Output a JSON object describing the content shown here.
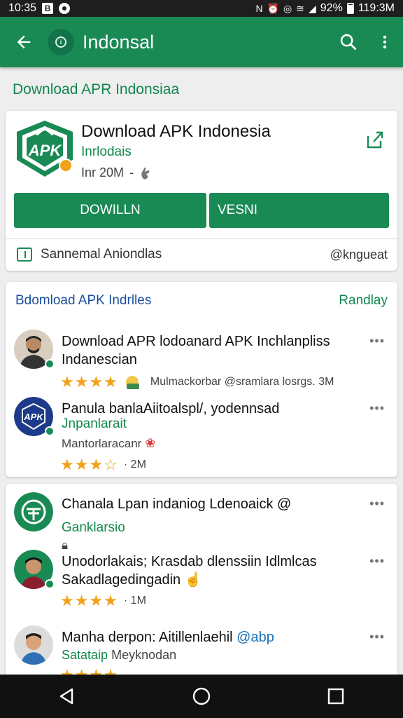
{
  "status_bar": {
    "time": "10:35",
    "battery": "92%",
    "clock_right": "119:3M"
  },
  "app_bar": {
    "title": "Indonsal"
  },
  "page_heading": "Download APR Indonsiaa",
  "app_card": {
    "name": "Download APK Indonesia",
    "developer": "Inrlodais",
    "meta_size": "Inr 20M",
    "meta_sep": "-",
    "download_label": "DOWILLN",
    "version_label": "VESNI",
    "footer_label": "Sannemal Aniondlas",
    "footer_handle": "@kngueat",
    "logo_text": "APK"
  },
  "list_1": {
    "title": "Bdomload APK Indrlles",
    "action": "Randlay",
    "items": [
      {
        "title": "Download APR lodoanard APK Inchlanpliss Indanescian",
        "rating_stars": "★★★★",
        "rating_text": "Mulmackorbar @sramlara losrgs. 3M",
        "more": "•••"
      },
      {
        "title": "Panula banlaAiitoalspl/, yodennsad",
        "sub": "Jnpanlarait",
        "sub2": "Mantorlaracanr",
        "rating_stars": "★★★☆",
        "rating_text": "· 2M",
        "more": "•••",
        "logo_text": "APK"
      }
    ]
  },
  "list_2": {
    "items": [
      {
        "title": "Chanala Lpan indaniog Ldenoaick @",
        "sub": "Ganklarsio",
        "more": "•••"
      },
      {
        "title": "Unodorlakais; Krasdab dlenssiin Idlmlcas Sakadlagedingadin",
        "rating_stars": "★★★★",
        "rating_text": "· 1M",
        "more": "•••"
      },
      {
        "title": "Manha derpon: Aitillenlaehil",
        "title_handle": "@abp",
        "sub": "Satataip",
        "sub2": "Meyknodan",
        "rating_stars": "★★★★",
        "more": "•••"
      }
    ]
  },
  "colors": {
    "primary": "#1a8a55",
    "star": "#f2a21a",
    "link_blue": "#1a4f9c"
  },
  "icons": [
    "back-arrow-icon",
    "search-icon",
    "more-vert-icon",
    "share-icon",
    "back-nav-icon",
    "home-nav-icon",
    "recents-nav-icon"
  ]
}
